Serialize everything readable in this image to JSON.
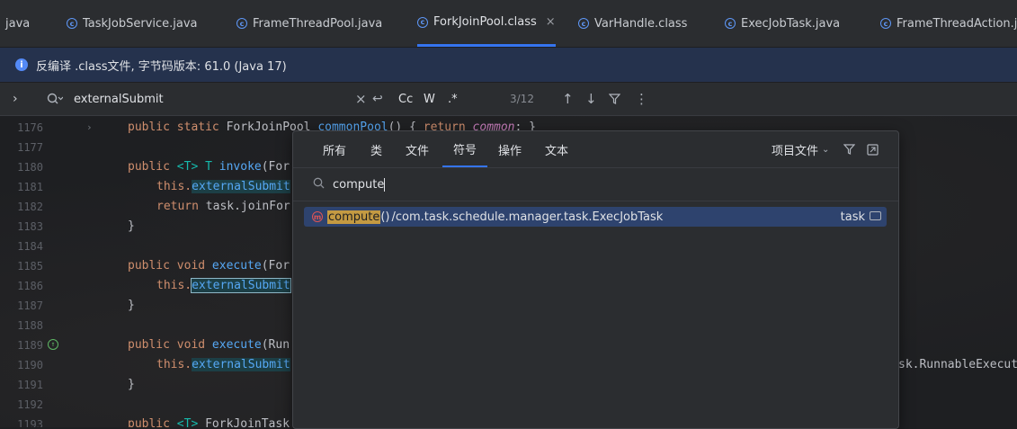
{
  "tabs": [
    {
      "label": "java",
      "icon": "none"
    },
    {
      "label": "TaskJobService.java",
      "icon": "class-icon"
    },
    {
      "label": "FrameThreadPool.java",
      "icon": "class-icon"
    },
    {
      "label": "ForkJoinPool.class",
      "icon": "class-icon",
      "active": true,
      "close": "×"
    },
    {
      "label": "VarHandle.class",
      "icon": "class-icon"
    },
    {
      "label": "ExecJobTask.java",
      "icon": "class-icon"
    },
    {
      "label": "FrameThreadAction.ja",
      "icon": "class-icon"
    }
  ],
  "banner": {
    "text": "反编译 .class文件, 字节码版本: 61.0 (Java 17)"
  },
  "search": {
    "value": "externalSubmit",
    "clear": "×",
    "options": [
      "Cc",
      "W",
      ".*"
    ],
    "count": "3/12"
  },
  "editor": {
    "lines": [
      {
        "n": "1176",
        "fold": true
      },
      {
        "n": "1177"
      },
      {
        "n": "1180"
      },
      {
        "n": "1181"
      },
      {
        "n": "1182"
      },
      {
        "n": "1183"
      },
      {
        "n": "1184"
      },
      {
        "n": "1185"
      },
      {
        "n": "1186"
      },
      {
        "n": "1187"
      },
      {
        "n": "1188"
      },
      {
        "n": "1189"
      },
      {
        "n": "1190"
      },
      {
        "n": "1191"
      },
      {
        "n": "1192"
      },
      {
        "n": "1193"
      }
    ],
    "code": {
      "l1176_a": "public static ",
      "l1176_b": "ForkJoinPool ",
      "l1176_c": "commonPool",
      "l1176_d": "() { ",
      "l1176_e": "return ",
      "l1176_f": "common",
      "l1176_g": "; }",
      "l1180_a": "public ",
      "l1180_b": "<T> T ",
      "l1180_c": "invoke",
      "l1180_d": "(For",
      "l1181_a": "this.",
      "l1181_b": "externalSubmit",
      "l1182_a": "return ",
      "l1182_b": "task.joinFor",
      "l1183": "}",
      "l1185_a": "public void ",
      "l1185_b": "execute",
      "l1185_c": "(For",
      "l1186_a": "this.",
      "l1186_b": "externalSubmit",
      "l1187": "}",
      "l1189_a": "public void ",
      "l1189_b": "execute",
      "l1189_c": "(Run",
      "l1190_a": "this.",
      "l1190_b": "externalSubmit",
      "l1190_tail": "sk.RunnableExecut",
      "l1191": "}",
      "l1193_a": "public ",
      "l1193_b": "<T> ",
      "l1193_c": "ForkJoinTask"
    }
  },
  "popup": {
    "tabs": [
      "所有",
      "类",
      "文件",
      "符号",
      "操作",
      "文本"
    ],
    "active_tab": "符号",
    "scope": "项目文件",
    "query": "compute",
    "result": {
      "match": "compute",
      "rest": "()",
      "path": "/com.task.schedule.manager.task.ExecJobTask",
      "location": "task"
    }
  },
  "colors": {
    "accent": "#3574f0",
    "keyword": "#cf8e6d",
    "function": "#56a8f5",
    "match": "#c49a42"
  }
}
